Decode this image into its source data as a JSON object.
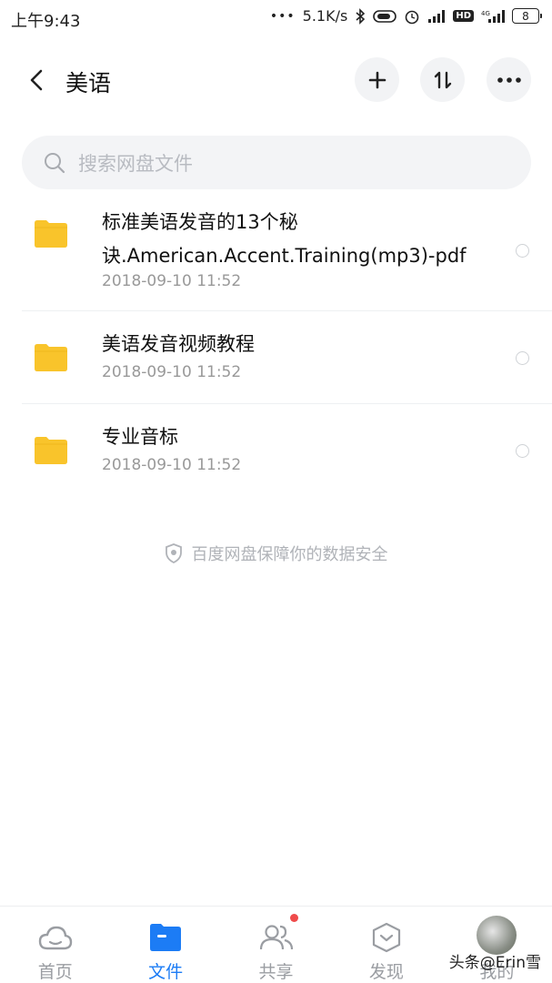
{
  "status_bar": {
    "time": "上午9:43",
    "network_speed": "5.1K/s",
    "hd_badge": "HD",
    "battery": "8"
  },
  "header": {
    "title": "美语"
  },
  "search": {
    "placeholder": "搜索网盘文件"
  },
  "files": [
    {
      "name": "标准美语发音的13个秘诀.American.Accent.Training(mp3)-pdf",
      "date": "2018-09-10  11:52"
    },
    {
      "name": "美语发音视频教程",
      "date": "2018-09-10  11:52"
    },
    {
      "name": "专业音标",
      "date": "2018-09-10  11:52"
    }
  ],
  "safety_note": "百度网盘保障你的数据安全",
  "bottom_nav": [
    {
      "label": "首页",
      "icon": "cloud-icon"
    },
    {
      "label": "文件",
      "icon": "folder-icon"
    },
    {
      "label": "共享",
      "icon": "people-icon"
    },
    {
      "label": "发现",
      "icon": "discover-icon"
    },
    {
      "label": "我的",
      "icon": "avatar"
    }
  ],
  "watermark": "头条@Erin雪",
  "colors": {
    "accent": "#1c7cf5",
    "folder": "#f9c42b",
    "badge": "#ef4a4a"
  }
}
